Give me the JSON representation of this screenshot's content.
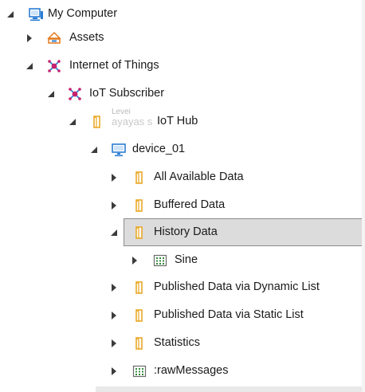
{
  "tree": {
    "my_computer": "My Computer",
    "assets": "Assets",
    "internet_of_things": "Internet of Things",
    "iot_subscriber": "IoT Subscriber",
    "iot_hub": "IoT Hub",
    "iot_hub_ghost_text": "ayayas s",
    "iot_hub_ghost_overlay": "Levei",
    "device": "device_01",
    "all_available_data": "All Available Data",
    "buffered_data": "Buffered Data",
    "history_data": "History Data",
    "sine": "Sine",
    "published_dynamic": "Published Data via Dynamic List",
    "published_static": "Published Data via Static List",
    "statistics": "Statistics",
    "raw_messages": ":rawMessages"
  },
  "colors": {
    "selection_bg": "#dcdcdc",
    "selection_border": "#8c8c8c",
    "arrow": "#3b3b3b",
    "folder": "#e8a319",
    "computer": "#2b7cd3",
    "iot_magenta": "#c8216f",
    "iot_blue": "#2b7cd3"
  },
  "icons": {
    "computer": "computer-icon",
    "assets": "assets-icon",
    "iot": "iot-network-icon",
    "folder": "folder-icon",
    "tag": "data-tag-icon",
    "expanded": "expanded-arrow-icon",
    "collapsed": "collapsed-arrow-icon"
  }
}
